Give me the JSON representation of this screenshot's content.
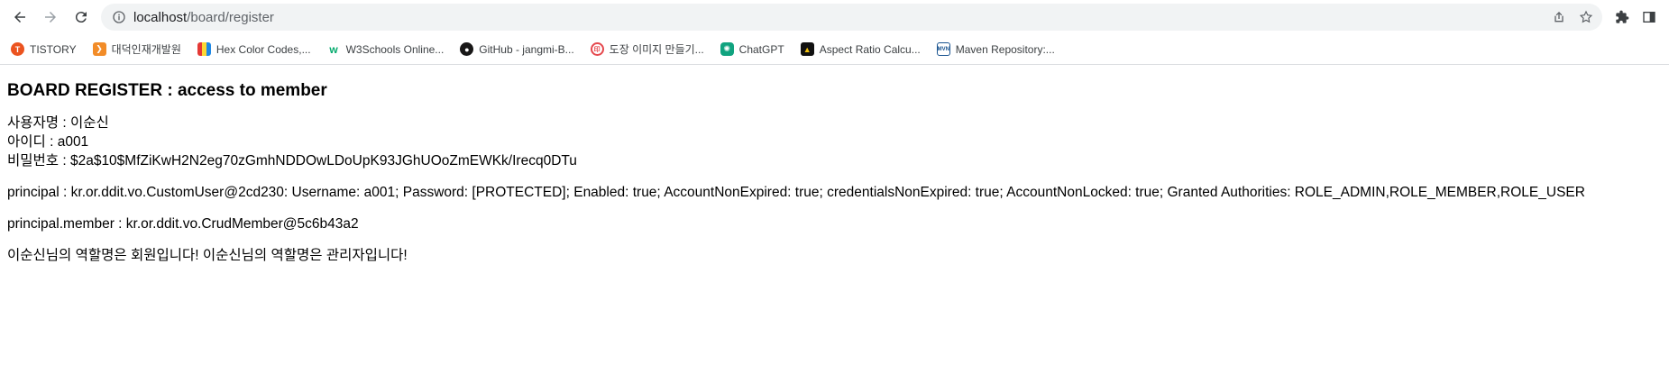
{
  "browser": {
    "url_host": "localhost",
    "url_path": "/board/register"
  },
  "bookmarks": [
    {
      "label": "TISTORY",
      "icon": "tistory-icon",
      "color": "#eb531f"
    },
    {
      "label": "대덕인재개발원",
      "icon": "ddit-icon",
      "color": "#f28c28"
    },
    {
      "label": "Hex Color Codes,...",
      "icon": "hex-color-icon",
      "color": "#3366cc"
    },
    {
      "label": "W3Schools Online...",
      "icon": "w3schools-icon",
      "color": "#04aa6d"
    },
    {
      "label": "GitHub - jangmi-B...",
      "icon": "github-icon",
      "color": "#181717"
    },
    {
      "label": "도장 이미지 만들기...",
      "icon": "stamp-icon",
      "color": "#e5484d"
    },
    {
      "label": "ChatGPT",
      "icon": "chatgpt-icon",
      "color": "#10a37f"
    },
    {
      "label": "Aspect Ratio Calcu...",
      "icon": "aspect-ratio-icon",
      "color": "#f4c20d"
    },
    {
      "label": "Maven Repository:...",
      "icon": "maven-icon",
      "color": "#1a5490"
    }
  ],
  "page": {
    "title": "BOARD REGISTER : access to member",
    "username_line": "사용자명 : 이순신",
    "id_line": "아이디 : a001",
    "password_line": "비밀번호 : $2a$10$MfZiKwH2N2eg70zGmhNDDOwLDoUpK93JGhUOoZmEWKk/Irecq0DTu",
    "principal_line": "principal : kr.or.ddit.vo.CustomUser@2cd230: Username: a001; Password: [PROTECTED]; Enabled: true; AccountNonExpired: true; credentialsNonExpired: true; AccountNonLocked: true; Granted Authorities: ROLE_ADMIN,ROLE_MEMBER,ROLE_USER",
    "member_line": "principal.member : kr.or.ddit.vo.CrudMember@5c6b43a2",
    "role_line": "이순신님의 역할명은 회원입니다! 이순신님의 역할명은 관리자입니다!"
  }
}
